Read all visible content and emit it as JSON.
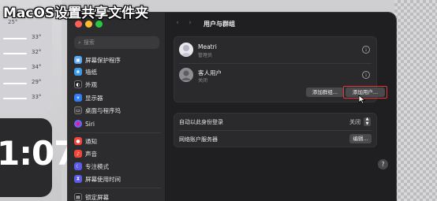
{
  "overlay": {
    "title": "MacOS设置共享文件夹"
  },
  "desktop": {
    "top_temp": "25°",
    "temps": [
      "33°",
      "32°",
      "34°",
      "29°",
      "33°"
    ],
    "clock": "1:07"
  },
  "sidebar": {
    "search_placeholder": "搜索",
    "items": [
      {
        "label": "屏幕保护程序",
        "icon": "screensaver-icon",
        "color": "#5aa7f5"
      },
      {
        "label": "墙纸",
        "icon": "wallpaper-icon",
        "color": "#3b9ae8"
      },
      {
        "label": "外观",
        "icon": "appearance-icon",
        "color": "#1c1c1e"
      },
      {
        "label": "显示器",
        "icon": "display-icon",
        "color": "#2f7df6"
      },
      {
        "label": "桌面与程序坞",
        "icon": "dock-icon",
        "color": "#3a3a3c"
      },
      {
        "label": "Siri",
        "icon": "siri-icon",
        "color": "#7b5cf2"
      },
      {
        "label": "通知",
        "icon": "notifications-icon",
        "color": "#f0453a"
      },
      {
        "label": "声音",
        "icon": "sound-icon",
        "color": "#f0453a"
      },
      {
        "label": "专注模式",
        "icon": "focus-icon",
        "color": "#5e5ce6"
      },
      {
        "label": "屏幕使用时间",
        "icon": "screen-time-icon",
        "color": "#5e5ce6"
      },
      {
        "label": "锁定屏幕",
        "icon": "lock-screen-icon",
        "color": "#1c1c1e"
      }
    ]
  },
  "main": {
    "title": "用户与群组",
    "users": [
      {
        "name": "Meatri",
        "role": "管理员"
      },
      {
        "name": "客人用户",
        "role": "关闭"
      }
    ],
    "add_group_label": "添加群组...",
    "add_user_label": "添加用户...",
    "auto_login_label": "自动以此身份登录",
    "auto_login_value": "关闭",
    "network_server_label": "网络账户服务器",
    "edit_label": "编辑...",
    "help_label": "?"
  },
  "colors": {
    "highlight": "#e53935",
    "accent": "#2f7df6"
  }
}
